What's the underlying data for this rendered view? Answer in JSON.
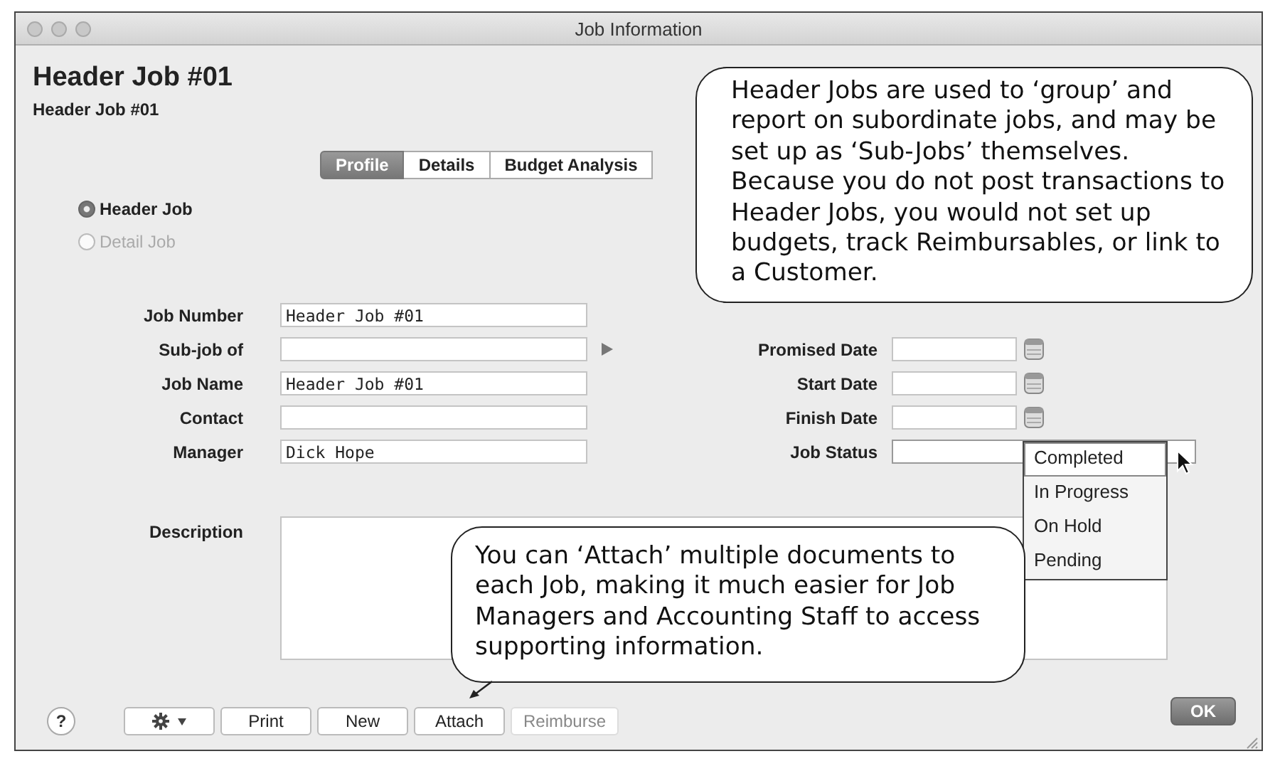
{
  "window": {
    "title": "Job Information"
  },
  "heading": "Header Job #01",
  "subheading": "Header Job #01",
  "tabs": [
    {
      "label": "Profile",
      "selected": true
    },
    {
      "label": "Details",
      "selected": false
    },
    {
      "label": "Budget Analysis",
      "selected": false
    }
  ],
  "job_type": [
    {
      "label": "Header Job",
      "selected": true,
      "disabled": false
    },
    {
      "label": "Detail Job",
      "selected": false,
      "disabled": true
    }
  ],
  "left_fields": [
    {
      "label": "Job Number",
      "value": "Header Job #01",
      "kind": "text"
    },
    {
      "label": "Sub-job of",
      "kind": "lookup"
    },
    {
      "label": "Job Name",
      "value": "Header Job #01",
      "kind": "text"
    },
    {
      "label": "Contact",
      "kind": "text"
    },
    {
      "label": "Manager",
      "value": "Dick Hope",
      "kind": "text"
    }
  ],
  "right_fields": [
    {
      "label": "Promised Date",
      "kind": "date"
    },
    {
      "label": "Start Date",
      "kind": "date"
    },
    {
      "label": "Finish Date",
      "kind": "date"
    },
    {
      "label": "Job Status",
      "kind": "select"
    }
  ],
  "status_menu": [
    {
      "label": "Completed",
      "selected": true
    },
    {
      "label": "In Progress",
      "selected": false
    },
    {
      "label": "On Hold",
      "selected": false
    },
    {
      "label": "Pending",
      "selected": false
    }
  ],
  "description": {
    "label": "Description"
  },
  "toolbar": {
    "help": "?",
    "buttons": [
      {
        "kind": "gear",
        "disabled": false
      },
      {
        "kind": "text",
        "label": "Print",
        "disabled": false
      },
      {
        "kind": "text",
        "label": "New",
        "disabled": false
      },
      {
        "kind": "text",
        "label": "Attach",
        "disabled": false
      },
      {
        "kind": "text",
        "label": "Reimburse",
        "disabled": true
      }
    ]
  },
  "ok_button": "OK",
  "callouts": [
    {
      "text": "Header Jobs are used to ‘group’ and report on subordinate jobs, and may be set up as ‘Sub-Jobs’ themselves. Because you do not post transactions to Header Jobs, you would not set up budgets, track Reimbursables, or link to a Customer."
    },
    {
      "text": "You can ‘Attach’ multiple documents to each Job, making it much easier for Job Managers and Accounting Staff to access supporting information."
    }
  ]
}
